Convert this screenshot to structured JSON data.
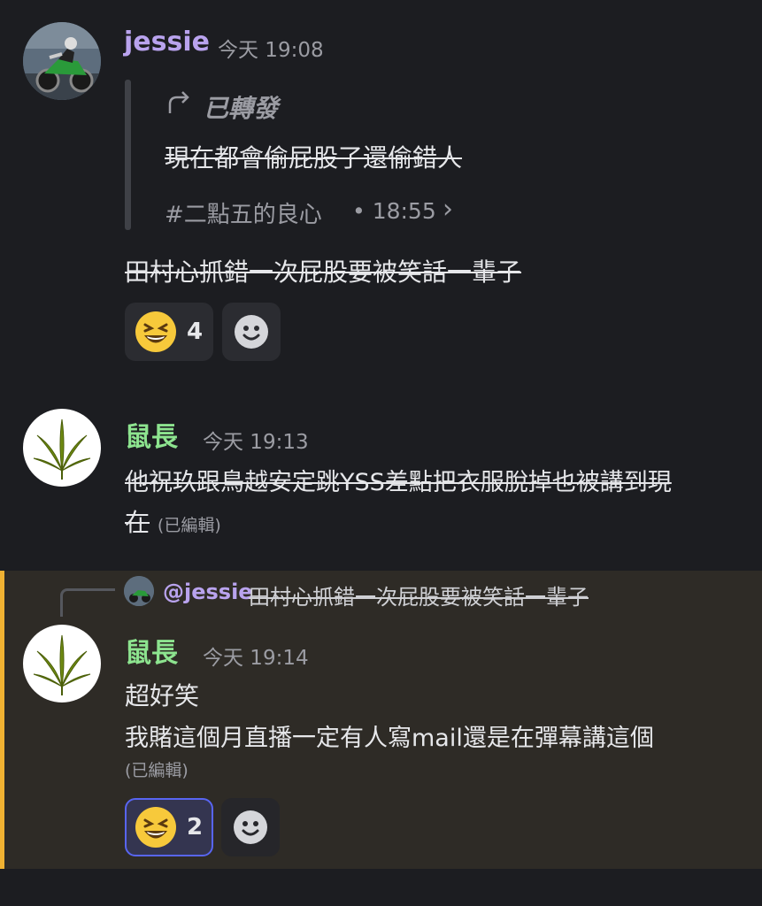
{
  "messages": [
    {
      "author": "jessie",
      "author_color": "#b9a3ee",
      "time": "今天 19:08",
      "forward": {
        "label": "已轉發",
        "text": "現在都會偷屁股了還偷錯人",
        "source": "#二點五的良心",
        "source_time": "• 18:55",
        "chevron": "›"
      },
      "text": "田村心抓錯一次屁股要被笑話一輩子",
      "reactions": [
        {
          "emoji": "laughing-face",
          "count": "4"
        }
      ],
      "add_reaction_icon": "smile-icon"
    },
    {
      "author": "鼠長",
      "author_color": "#8de48f",
      "time": "今天 19:13",
      "text_line1": "他祝玖跟鳥越安定跳YSS差點把衣服脫掉也被講到現",
      "text_line2": "在",
      "edited": "(已編輯)"
    },
    {
      "author": "鼠長",
      "author_color": "#8de48f",
      "time": "今天 19:14",
      "reply": {
        "mention": "@jessie",
        "text": "田村心抓錯一次屁股要被笑話一輩子"
      },
      "text_line1": "超好笑",
      "text_line2": "我賭這個月直播一定有人寫mail還是在彈幕講這個",
      "edited": "(已編輯)",
      "reactions": [
        {
          "emoji": "laughing-face",
          "count": "2",
          "active": true
        }
      ],
      "add_reaction_icon": "smile-icon"
    }
  ],
  "colors": {
    "background": "#1c1d21",
    "highlight_background": "#2e2b26",
    "highlight_bar": "#f0b232",
    "accent": "#5865f2"
  }
}
